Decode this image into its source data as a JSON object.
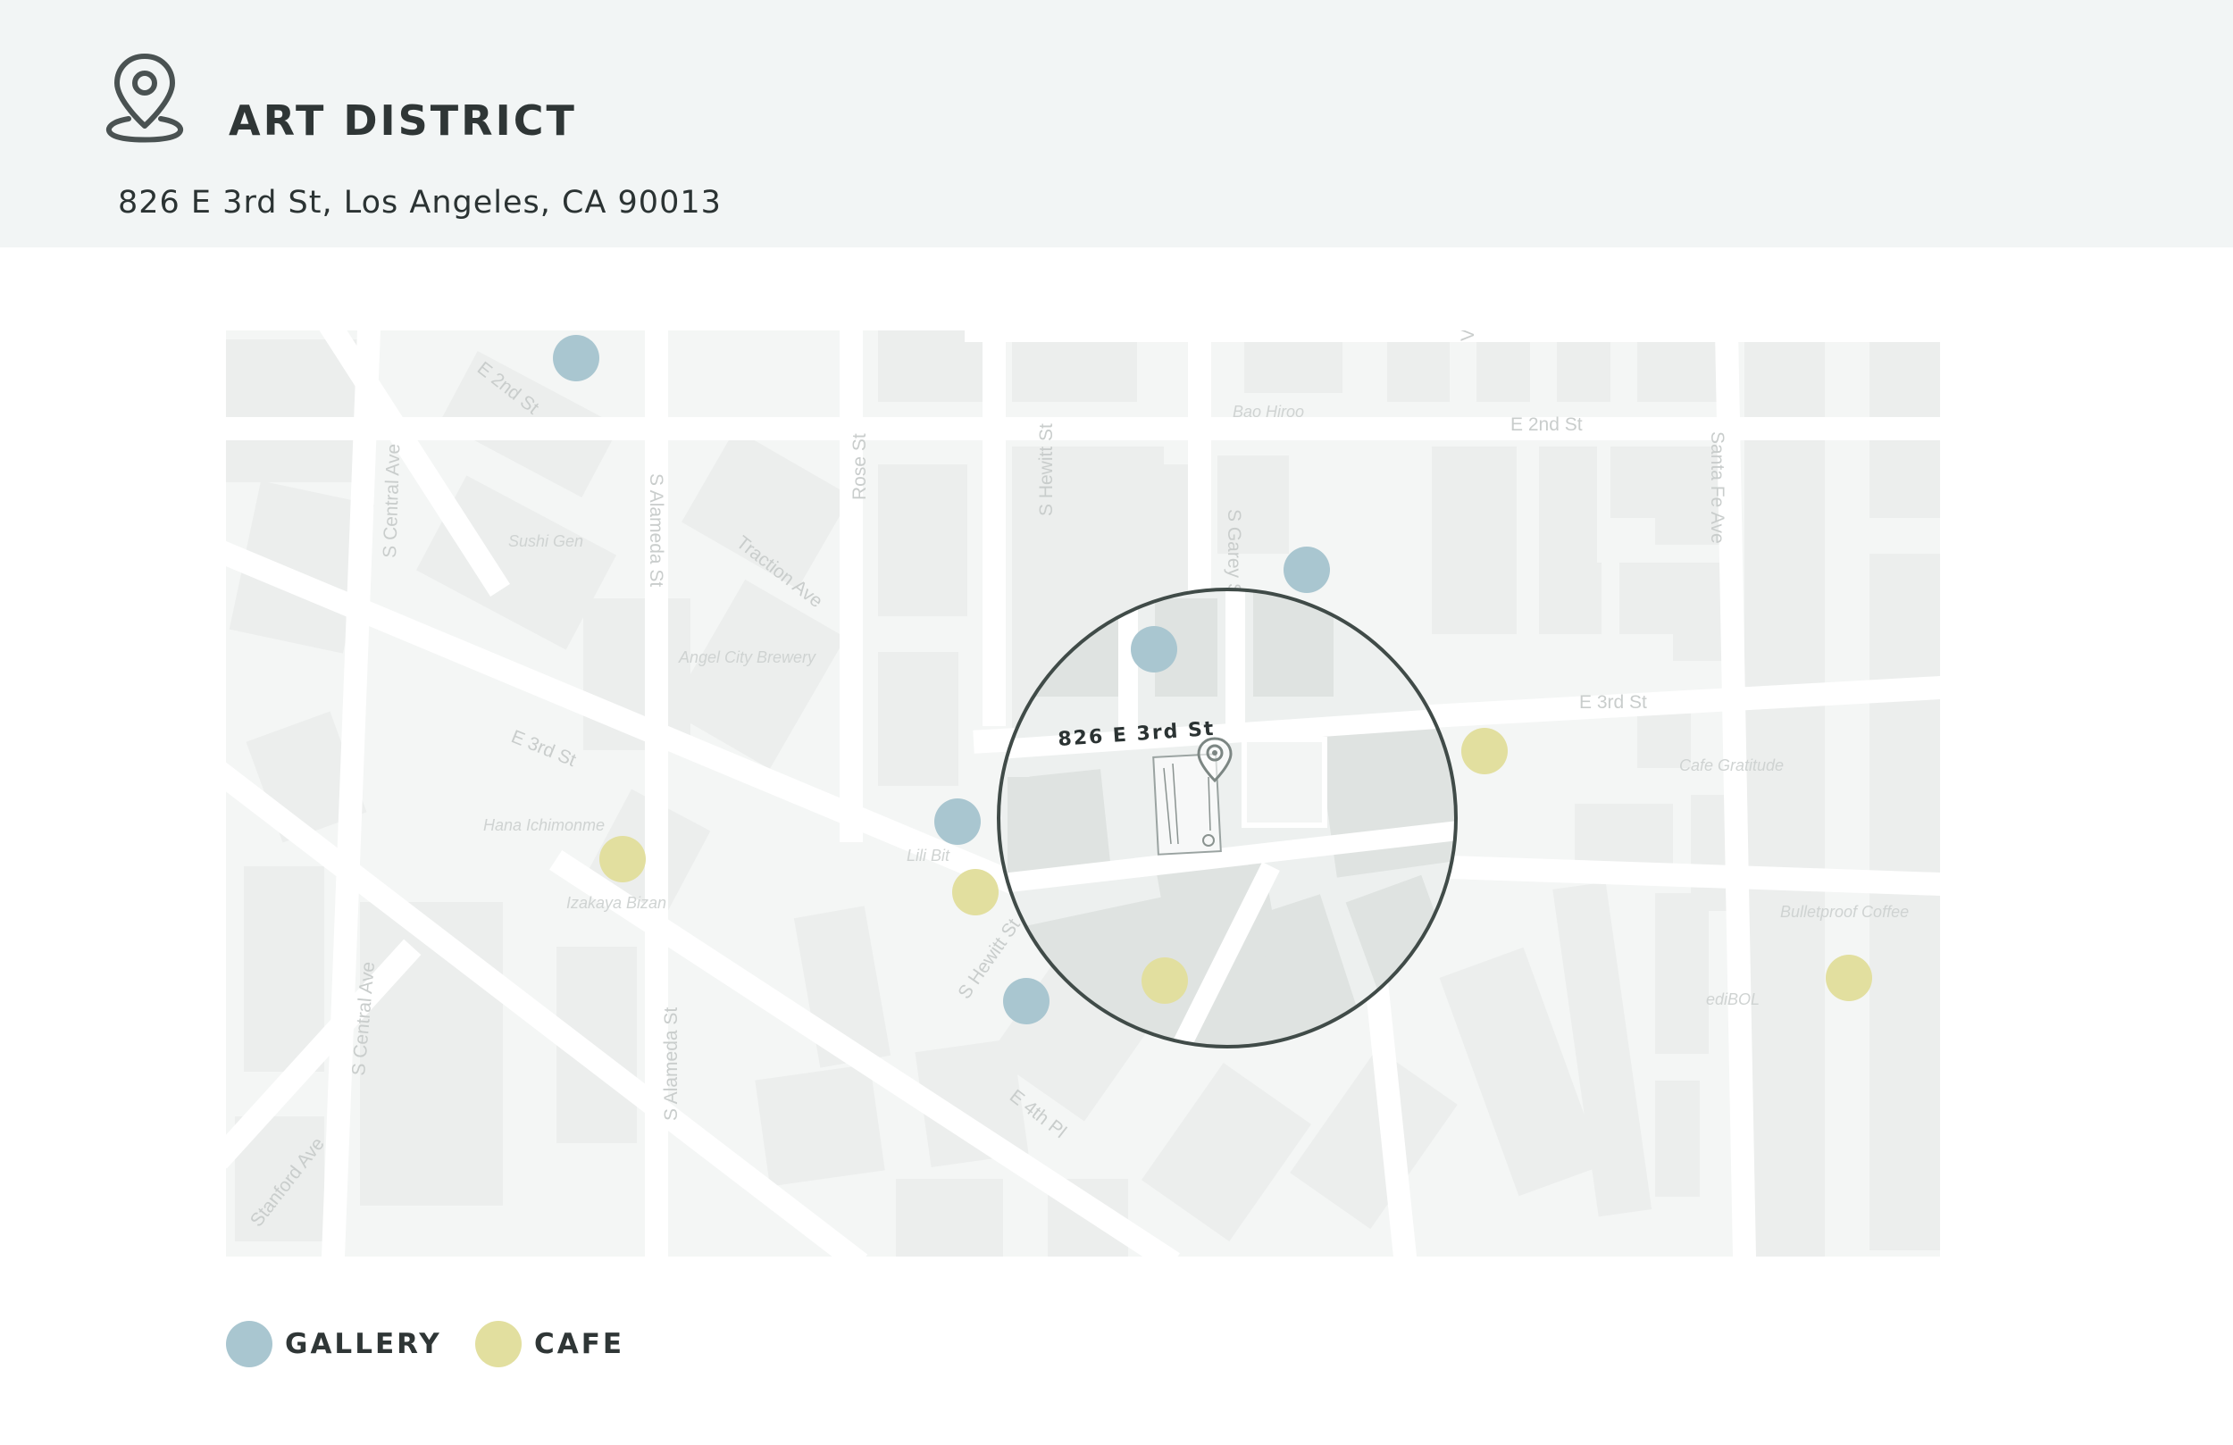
{
  "header": {
    "title": "ART DISTRICT",
    "address": "826 E 3rd St, Los Angeles, CA 90013",
    "icon": "location-pin-icon"
  },
  "map": {
    "highlight_label": "826 E 3rd St",
    "street_labels": [
      "E 2nd St",
      "S Central Ave",
      "S Alameda St",
      "Rose St",
      "S Hewitt St",
      "S Garey St",
      "Traction Ave",
      "E 2nd St",
      "Santa Fe Ave",
      "E 3rd St",
      "E 3rd St",
      "S Central Ave",
      "S Alameda St",
      "S Hewitt St",
      "E 4th Pl",
      "Stanford Ave",
      "Vi"
    ],
    "poi_labels": [
      "Sushi Gen",
      "Angel City Brewery",
      "Bao Hiroo",
      "Hana Ichimonme",
      "Izakaya Bizan",
      "Lili Bit",
      "Cafe Gratitude",
      "Bulletproof Coffee",
      "ediBOL"
    ]
  },
  "legend": [
    {
      "label": "GALLERY",
      "color": "#a9c6d0"
    },
    {
      "label": "CAFE",
      "color": "#e2df9f"
    }
  ],
  "colors": {
    "gallery": "#a9c6d0",
    "cafe": "#e2df9f",
    "ring": "#404b48",
    "header_bg": "#f2f5f5"
  }
}
